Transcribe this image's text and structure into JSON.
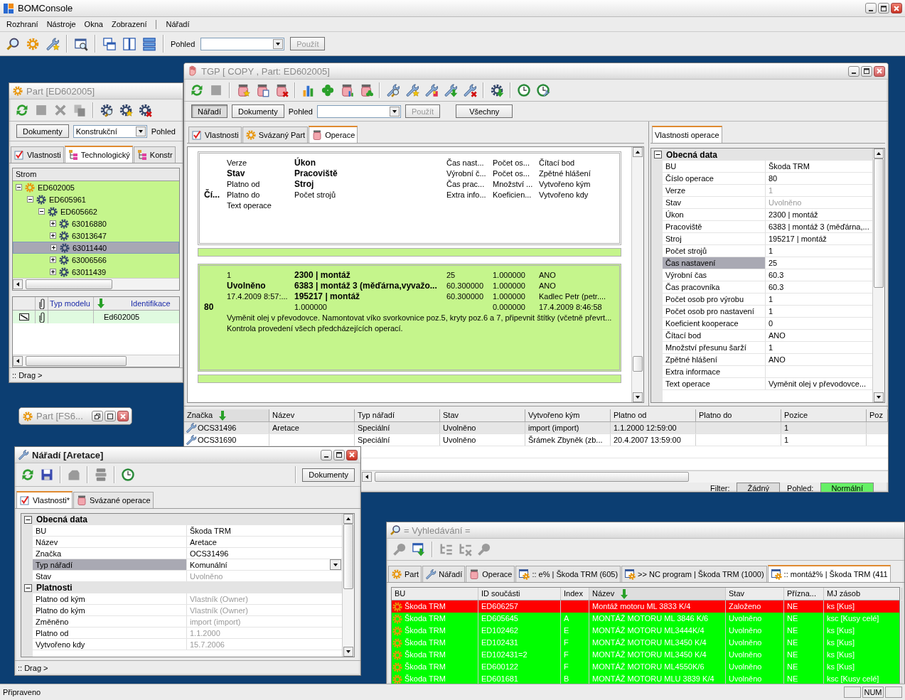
{
  "app": {
    "title": "BOMConsole",
    "menu": [
      "Rozhraní",
      "Nástroje",
      "Okna",
      "Zobrazení"
    ],
    "menu_tools": [
      "Nářadí"
    ],
    "view_label": "Pohled",
    "apply_button": {
      "label": "Použít",
      "disabled": true
    },
    "status": "Připraveno",
    "num_indicator": "NUM"
  },
  "part_window": {
    "title": "Part [ED602005]",
    "documents_button": "Dokumenty",
    "model_select": "Konstrukční",
    "view_label": "Pohled",
    "tabs": [
      {
        "label": "Vlastnosti",
        "selected": false
      },
      {
        "label": "Technologický",
        "selected": true
      },
      {
        "label": "Konstr",
        "selected": false
      }
    ],
    "tree_header": "Strom",
    "tree": [
      {
        "label": "ED602005",
        "expanded": true,
        "selected": false,
        "children": [
          {
            "label": "ED605961",
            "expanded": true,
            "selected": false,
            "children": [
              {
                "label": "ED605662",
                "expanded": true,
                "selected": false,
                "children": [
                  {
                    "label": "63016880",
                    "expanded": false,
                    "selected": false
                  },
                  {
                    "label": "63013647",
                    "expanded": false,
                    "selected": false
                  },
                  {
                    "label": "63011440",
                    "expanded": false,
                    "selected": true
                  },
                  {
                    "label": "63006566",
                    "expanded": false,
                    "selected": false
                  },
                  {
                    "label": "63011439",
                    "expanded": false,
                    "selected": false
                  }
                ]
              }
            ]
          }
        ]
      }
    ],
    "doc_columns": [
      {
        "label": "Typ modelu",
        "sorted": false
      },
      {
        "label": "Identifikace",
        "sorted": true
      }
    ],
    "doc_rows": [
      {
        "identifikace": "Ed602005"
      }
    ],
    "status": ":: Drag >"
  },
  "minimized_window": {
    "title": "Part [FS6..."
  },
  "tgp_window": {
    "title": "TGP [ COPY , Part: ED602005]",
    "mode_buttons": [
      {
        "label": "Nářadí",
        "selected": true
      },
      {
        "label": "Dokumenty",
        "selected": false
      }
    ],
    "view_label": "Pohled",
    "apply_button": {
      "label": "Použít",
      "disabled": true
    },
    "all_button": "Všechny",
    "tabs": [
      {
        "label": "Vlastnosti",
        "selected": false
      },
      {
        "label": "Svázaný Part",
        "selected": false
      },
      {
        "label": "Operace",
        "selected": true
      }
    ],
    "layout_card": {
      "rows": [
        [
          null,
          {
            "text": "Verze",
            "bold": false
          },
          {
            "text": "Úkon",
            "bold": true
          },
          {
            "text": "Čas nast...",
            "bold": false
          },
          {
            "text": "Počet os...",
            "bold": false
          },
          {
            "text": "Čítací bod",
            "bold": false
          }
        ],
        [
          null,
          {
            "text": "Stav",
            "bold": true
          },
          {
            "text": "Pracoviště",
            "bold": true
          },
          {
            "text": "Výrobní č...",
            "bold": false
          },
          {
            "text": "Počet os...",
            "bold": false
          },
          {
            "text": "Zpětné hlášení",
            "bold": false
          }
        ],
        [
          null,
          {
            "text": "Platno od",
            "bold": false
          },
          {
            "text": "Stroj",
            "bold": true
          },
          {
            "text": "Čas prac...",
            "bold": false
          },
          {
            "text": "Množství ...",
            "bold": false
          },
          {
            "text": "Vytvořeno kým",
            "bold": false
          }
        ],
        [
          {
            "text": "Čí...",
            "bold": true
          },
          {
            "text": "Platno do",
            "bold": false
          },
          {
            "text": "Počet strojů",
            "bold": false
          },
          {
            "text": "Extra info...",
            "bold": false
          },
          {
            "text": "Koeficien...",
            "bold": false
          },
          {
            "text": "Vytvořeno kdy",
            "bold": false
          }
        ]
      ],
      "text_lines": [
        "Text operace"
      ]
    },
    "operation_card": {
      "rows": [
        [
          null,
          {
            "text": "1",
            "bold": false
          },
          {
            "text": "2300  | montáž",
            "bold": true
          },
          {
            "text": "25",
            "bold": false
          },
          {
            "text": "1.000000",
            "bold": false
          },
          {
            "text": "ANO",
            "bold": false
          }
        ],
        [
          null,
          {
            "text": "Uvolněno",
            "bold": true
          },
          {
            "text": "6383 | montáž 3 (měďárna,vyvažo...",
            "bold": true
          },
          {
            "text": "60.300000",
            "bold": false
          },
          {
            "text": "1.000000",
            "bold": false
          },
          {
            "text": "ANO",
            "bold": false
          }
        ],
        [
          null,
          {
            "text": "17.4.2009 8:57:...",
            "bold": false
          },
          {
            "text": "195217 | montáž",
            "bold": true
          },
          {
            "text": "60.300000",
            "bold": false
          },
          {
            "text": "1.000000",
            "bold": false
          },
          {
            "text": "Kadlec Petr (petr....",
            "bold": false
          }
        ],
        [
          {
            "text": "80",
            "bold": true
          },
          null,
          {
            "text": "1.000000",
            "bold": false
          },
          null,
          {
            "text": "0.000000",
            "bold": false
          },
          {
            "text": "17.4.2009 8:46:58",
            "bold": false
          }
        ]
      ],
      "text_lines": [
        "Vyměnit olej v převodovce. Namontovat víko svorkovnice poz.5, kryty poz.6 a 7, připevnit štítky (včetně převrt...",
        "Kontrola provedení všech předcházejících operací."
      ]
    },
    "tools_table": {
      "columns": [
        {
          "label": "Značka",
          "sorted": true
        },
        {
          "label": "Název",
          "sorted": false
        },
        {
          "label": "Typ nářadí",
          "sorted": false
        },
        {
          "label": "Stav",
          "sorted": false
        },
        {
          "label": "Vytvořeno kým",
          "sorted": false
        },
        {
          "label": "Platno od",
          "sorted": false
        },
        {
          "label": "Platno do",
          "sorted": false
        },
        {
          "label": "Pozice",
          "sorted": false
        },
        {
          "label": "Poz",
          "sorted": false
        }
      ],
      "rows": [
        {
          "selected": true,
          "cells": [
            "OCS31496",
            "Aretace",
            "Speciální",
            "Uvolněno",
            "import (import)",
            "1.1.2000 12:59:00",
            null,
            "1"
          ]
        },
        {
          "selected": false,
          "cells": [
            "OCS31690",
            null,
            "Speciální",
            "Uvolněno",
            "Šrámek Zbyněk (zb...",
            "20.4.2007 13:59:00",
            null,
            "1"
          ]
        }
      ]
    },
    "filter_label": "Filter:",
    "filter_value": "Žádný",
    "view_state_label": "Pohled:",
    "view_state_value": "Normální",
    "properties": {
      "tab": "Vlastnosti operace",
      "group": "Obecná data",
      "expanded": true,
      "rows": [
        {
          "name": "BU",
          "value": "Škoda TRM",
          "selected": false,
          "disabled": false
        },
        {
          "name": "Číslo operace",
          "value": "80",
          "selected": false,
          "disabled": false
        },
        {
          "name": "Verze",
          "value": "1",
          "selected": false,
          "disabled": true
        },
        {
          "name": "Stav",
          "value": "Uvolněno",
          "selected": false,
          "disabled": true
        },
        {
          "name": "Úkon",
          "value": "2300  | montáž",
          "selected": false,
          "disabled": false
        },
        {
          "name": "Pracoviště",
          "value": "6383 | montáž 3 (měďárna,...",
          "selected": false,
          "disabled": false
        },
        {
          "name": "Stroj",
          "value": "195217 | montáž",
          "selected": false,
          "disabled": false
        },
        {
          "name": "Počet strojů",
          "value": "1",
          "selected": false,
          "disabled": false
        },
        {
          "name": "Čas nastavení",
          "value": "25",
          "selected": true,
          "disabled": false
        },
        {
          "name": "Výrobní čas",
          "value": "60.3",
          "selected": false,
          "disabled": false
        },
        {
          "name": "Čas pracovníka",
          "value": "60.3",
          "selected": false,
          "disabled": false
        },
        {
          "name": "Počet osob pro výrobu",
          "value": "1",
          "selected": false,
          "disabled": false
        },
        {
          "name": "Počet osob pro nastavení",
          "value": "1",
          "selected": false,
          "disabled": false
        },
        {
          "name": "Koeficient kooperace",
          "value": "0",
          "selected": false,
          "disabled": false
        },
        {
          "name": "Čítací bod",
          "value": "ANO",
          "selected": false,
          "disabled": false
        },
        {
          "name": "Množství přesunu šarží",
          "value": "1",
          "selected": false,
          "disabled": false
        },
        {
          "name": "Zpětné hlášení",
          "value": "ANO",
          "selected": false,
          "disabled": false
        },
        {
          "name": "Extra informace",
          "value": null,
          "selected": false,
          "disabled": false
        },
        {
          "name": "Text operace",
          "value": "Vyměnit olej v převodovce...",
          "selected": false,
          "disabled": false
        }
      ]
    }
  },
  "tool_window": {
    "title": "Nářadí [Aretace]",
    "documents_button": "Dokumenty",
    "tabs": [
      {
        "label": "Vlastnosti*",
        "selected": true
      },
      {
        "label": "Svázané operace",
        "selected": false
      }
    ],
    "groups": [
      {
        "title": "Obecná data",
        "expanded": true,
        "rows": [
          {
            "name": "BU",
            "value": "Škoda TRM",
            "selected": false,
            "disabled": false,
            "kind": "text"
          },
          {
            "name": "Název",
            "value": "Aretace",
            "selected": false,
            "disabled": false,
            "kind": "text"
          },
          {
            "name": "Značka",
            "value": "OCS31496",
            "selected": false,
            "disabled": false,
            "kind": "text"
          },
          {
            "name": "Typ nářadí",
            "value": "Komunální",
            "selected": true,
            "disabled": false,
            "kind": "dropdown"
          },
          {
            "name": "Stav",
            "value": "Uvolněno",
            "selected": false,
            "disabled": true,
            "kind": "text"
          }
        ]
      },
      {
        "title": "Platnosti",
        "expanded": true,
        "rows": [
          {
            "name": "Platno od kým",
            "value": "Vlastník (Owner)",
            "selected": false,
            "disabled": true,
            "kind": "text"
          },
          {
            "name": "Platno do kým",
            "value": "Vlastník (Owner)",
            "selected": false,
            "disabled": true,
            "kind": "text"
          },
          {
            "name": "Změněno",
            "value": "import (import)",
            "selected": false,
            "disabled": true,
            "kind": "text"
          },
          {
            "name": "Platno od",
            "value": "1.1.2000",
            "selected": false,
            "disabled": true,
            "kind": "text"
          },
          {
            "name": "Vytvořeno kdy",
            "value": "15.7.2006",
            "selected": false,
            "disabled": true,
            "kind": "text"
          }
        ]
      }
    ],
    "status": ":: Drag >"
  },
  "search_window": {
    "title": "= Vyhledávání =",
    "tabs": [
      {
        "label": "Part",
        "selected": false
      },
      {
        "label": "Nářadí",
        "selected": false
      },
      {
        "label": "Operace",
        "selected": false
      },
      {
        "label": ":: e% | Škoda TRM (605)",
        "selected": false
      },
      {
        "label": ">> NC program | Škoda TRM (1000)",
        "selected": false
      },
      {
        "label": ":: montáž% | Škoda TRM (411",
        "selected": true
      }
    ],
    "columns": [
      {
        "label": "BU",
        "sorted": false
      },
      {
        "label": "ID součásti",
        "sorted": false
      },
      {
        "label": "Index",
        "sorted": false
      },
      {
        "label": "Název",
        "sorted": true
      },
      {
        "label": "Stav",
        "sorted": false
      },
      {
        "label": "Přízna...",
        "sorted": false
      },
      {
        "label": "MJ zásob",
        "sorted": false
      }
    ],
    "rows": [
      {
        "color": "#ff0000",
        "cells": [
          "Škoda TRM",
          "ED606257",
          null,
          "Montáž motoru ML 3833 K/4",
          "Založeno",
          "NE",
          "ks [Kus]"
        ]
      },
      {
        "color": "#00ff00",
        "cells": [
          "Škoda TRM",
          "ED605645",
          "A",
          "MONTÁŽ MOTORU ML 3846 K/6",
          "Uvolněno",
          "NE",
          "ksc [Kusy celé]"
        ]
      },
      {
        "color": "#00ff00",
        "cells": [
          "Škoda TRM",
          "ED102462",
          "E",
          "MONTÁŽ MOTORU ML3444K/4",
          "Uvolněno",
          "NE",
          "ks [Kus]"
        ]
      },
      {
        "color": "#00ff00",
        "cells": [
          "Škoda TRM",
          "ED102431",
          "F",
          "MONTÁŽ MOTORU ML3450 K/4",
          "Uvolněno",
          "NE",
          "ks [Kus]"
        ]
      },
      {
        "color": "#00ff00",
        "cells": [
          "Škoda TRM",
          "ED102431=2",
          "F",
          "MONTÁŽ MOTORU ML3450 K/4",
          "Uvolněno",
          "NE",
          "ks [Kus]"
        ]
      },
      {
        "color": "#00ff00",
        "cells": [
          "Škoda TRM",
          "ED600122",
          "F",
          "MONTÁŽ MOTORU ML4550K/6",
          "Uvolněno",
          "NE",
          "ks [Kus]"
        ]
      },
      {
        "color": "#00ff00",
        "cells": [
          "Škoda TRM",
          "ED601681",
          "B",
          "MONTÁŽ MOTORU MLU 3839 K/4",
          "Uvolněno",
          "NE",
          "ksc [Kusy celé]"
        ]
      }
    ]
  }
}
